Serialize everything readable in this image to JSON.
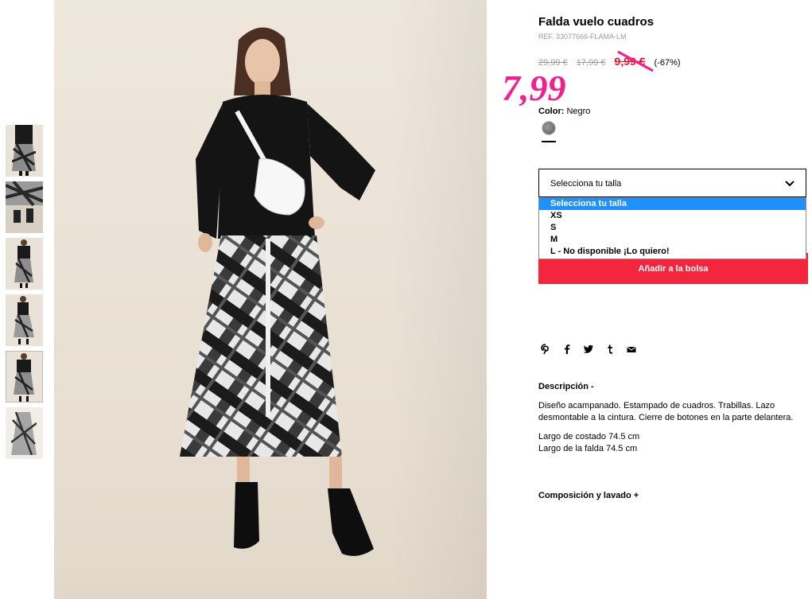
{
  "product": {
    "title": "Falda vuelo cuadros",
    "ref": "REF. 33077666-FLAMA-LM",
    "price_old_1": "29,99 €",
    "price_old_2": "17,99 €",
    "price_sale": "9,99 €",
    "discount": "(-67%)",
    "handwritten_price": "7,99",
    "color_label": "Color:",
    "color_value": "Negro",
    "swatch_color": "#7a7a7a"
  },
  "size_select": {
    "placeholder": "Selecciona tu talla",
    "options": [
      "Selecciona tu talla",
      "XS",
      "S",
      "M",
      "L - No disponible ¡Lo quiero!"
    ]
  },
  "add_to_bag": "Añadir a la bolsa",
  "share_icons": [
    "pinterest-icon",
    "facebook-icon",
    "twitter-icon",
    "tumblr-icon",
    "email-icon"
  ],
  "description": {
    "heading": "Descripción -",
    "paragraph1": "Diseño acampanado. Estampado de cuadros. Trabillas. Lazo desmontable a la cintura. Cierre de botones en la parte delantera.",
    "paragraph2_line1": "Largo de costado 74.5 cm",
    "paragraph2_line2": "Largo de la falda 74.5 cm"
  },
  "composition_heading": "Composición y lavado +",
  "colors": {
    "sale_red": "#e5132c",
    "button_red": "#f4263e",
    "handwritten_pink": "#f0208e",
    "selected_option_blue": "#1e90ff"
  }
}
